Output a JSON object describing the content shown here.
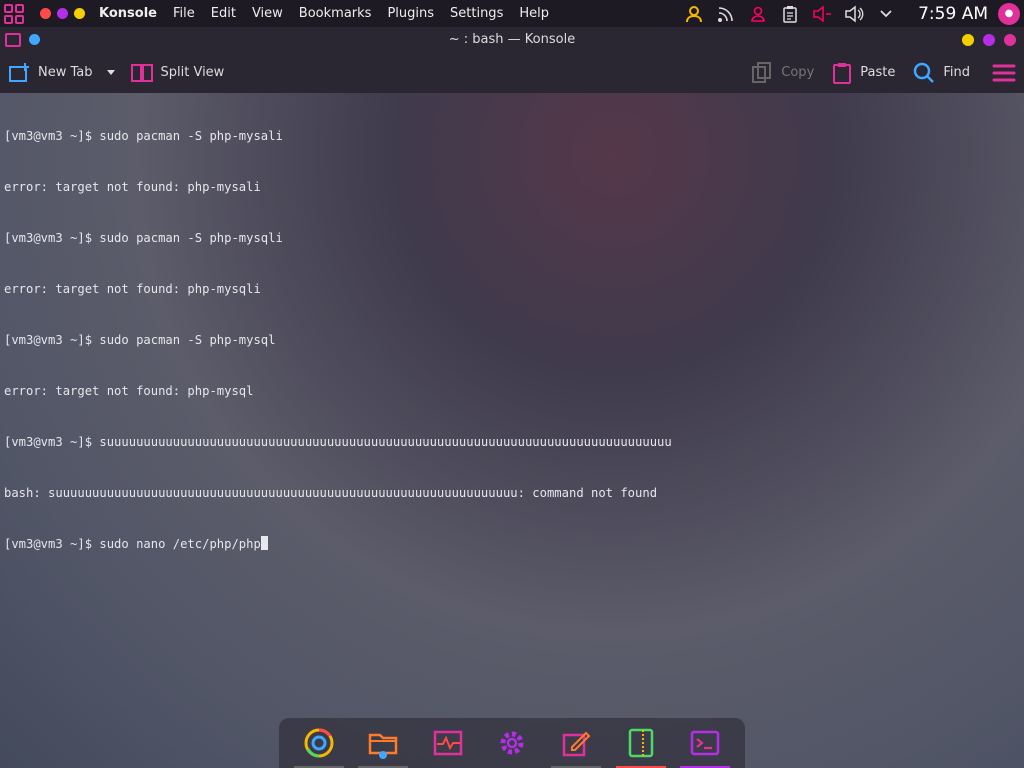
{
  "panel": {
    "app_name": "Konsole",
    "menu": [
      "File",
      "Edit",
      "View",
      "Bookmarks",
      "Plugins",
      "Settings",
      "Help"
    ],
    "clock": "7:59 AM",
    "tray_icons": [
      "user-icon",
      "rss-icon",
      "account-icon",
      "clipboard-icon",
      "mic-muted-icon",
      "volume-icon",
      "chevron-down-icon"
    ]
  },
  "window": {
    "title": "~ : bash — Konsole"
  },
  "toolbar": {
    "new_tab": "New Tab",
    "split_view": "Split View",
    "copy": "Copy",
    "paste": "Paste",
    "find": "Find"
  },
  "terminal": {
    "lines": [
      "[vm3@vm3 ~]$ sudo pacman -S php-mysali",
      "error: target not found: php-mysali",
      "[vm3@vm3 ~]$ sudo pacman -S php-mysqli",
      "error: target not found: php-mysqli",
      "[vm3@vm3 ~]$ sudo pacman -S php-mysql",
      "error: target not found: php-mysql",
      "[vm3@vm3 ~]$ suuuuuuuuuuuuuuuuuuuuuuuuuuuuuuuuuuuuuuuuuuuuuuuuuuuuuuuuuuuuuuuuuuuuuuuuuuuuu",
      "bash: suuuuuuuuuuuuuuuuuuuuuuuuuuuuuuuuuuuuuuuuuuuuuuuuuuuuuuuuuuuuuuu: command not found"
    ],
    "current_input": "[vm3@vm3 ~]$ sudo nano /etc/php/php"
  },
  "dock": [
    "chrome-icon",
    "file-manager-icon",
    "system-monitor-icon",
    "settings-icon",
    "text-editor-icon",
    "archive-icon",
    "konsole-icon"
  ],
  "colors": {
    "accent": "#e0309a",
    "panel_bg": "#1e1a24",
    "toolbar_bg": "#2a2632",
    "find_blue": "#3fa7ff"
  }
}
